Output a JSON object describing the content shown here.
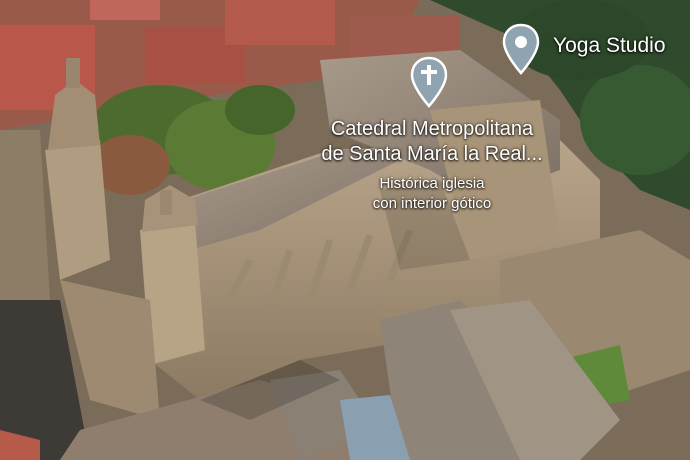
{
  "colors": {
    "pin_fill": "#8fa3b1",
    "pin_border": "#ffffff",
    "label_text": "#ffffff"
  },
  "markers": {
    "yoga": {
      "icon": "location-pin-icon",
      "name": "Yoga Studio"
    },
    "cathedral": {
      "icon": "church-cross-icon",
      "name_line1": "Catedral Metropolitana",
      "name_line2": "de Santa María la Real...",
      "desc_line1": "Histórica iglesia",
      "desc_line2": "con interior gótico"
    }
  }
}
